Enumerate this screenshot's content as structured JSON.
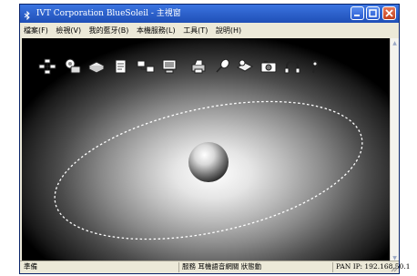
{
  "window": {
    "title": "IVT Corporation BlueSoleil - 主視窗"
  },
  "menu": {
    "items": [
      "檔案(F)",
      "檢視(V)",
      "我的藍牙(B)",
      "本機服務(L)",
      "工具(T)",
      "說明(H)"
    ]
  },
  "toolbar_services": [
    {
      "name": "network-service-icon"
    },
    {
      "name": "dialup-service-icon"
    },
    {
      "name": "fax-service-icon"
    },
    {
      "name": "file-transfer-service-icon"
    },
    {
      "name": "lan-access-service-icon"
    },
    {
      "name": "serial-port-service-icon"
    },
    {
      "name": "printer-service-icon"
    },
    {
      "name": "hid-service-icon"
    },
    {
      "name": "sync-service-icon"
    },
    {
      "name": "camera-service-icon"
    },
    {
      "name": "headset-service-icon"
    },
    {
      "name": "audio-gateway-service-icon"
    }
  ],
  "status": {
    "left": "準備",
    "middle": "服務 耳機語音網關 狀態動",
    "right": "PAN IP: 192.168.50.1"
  }
}
